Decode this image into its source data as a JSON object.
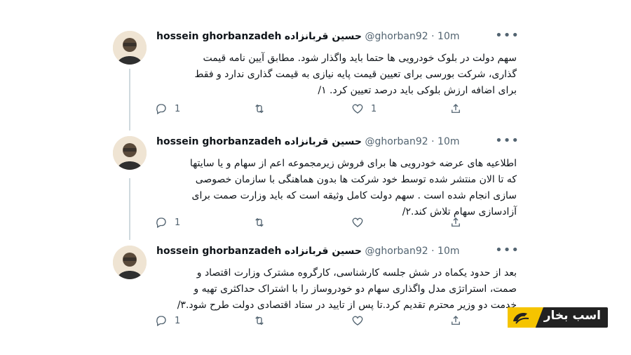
{
  "tweets": [
    {
      "name": "hossein ghorbanzadeh",
      "name_fa": "حسین قربانزاده",
      "handle": "@ghorban92",
      "time": "· 10m",
      "lines": [
        "سهم دولت در بلوک خودرویی ها حتما باید واگذار شود. مطابق آیین نامه قیمت",
        "گذاری، شرکت بورسی برای تعیین قیمت پایه نیازی به قیمت گذاری ندارد و فقط",
        "برای اضافه ارزش بلوکی باید درصد تعیین کرد. ۱/"
      ],
      "replies": "1",
      "retweets": "",
      "likes": "1"
    },
    {
      "name": "hossein ghorbanzadeh",
      "name_fa": "حسین قربانزاده",
      "handle": "@ghorban92",
      "time": "· 10m",
      "lines": [
        "اطلاعیه های عرضه خودرویی ها برای فروش زیرمجموعه اعم از سهام و یا سایتها",
        "که تا الان منتشر شده توسط خود شرکت ها بدون هماهنگی با سازمان خصوصی",
        "سازی انجام شده است . سهم دولت کامل وثیقه است که باید وزارت صمت برای",
        "آزادسازی سهام تلاش کند.۲/"
      ],
      "replies": "1",
      "retweets": "",
      "likes": ""
    },
    {
      "name": "hossein ghorbanzadeh",
      "name_fa": "حسین قربانزاده",
      "handle": "@ghorban92",
      "time": "· 10m",
      "lines": [
        "بعد از حدود یکماه در شش جلسه کارشناسی، کارگروه مشترک وزارت اقتصاد و",
        "صمت، استراتژی مدل واگذاری سهام دو خودروساز را با اشتراک حداکثری تهیه و",
        "خدمت دو وزیر محترم تقدیم کرد.تا پس از تایید در ستاد اقتصادی دولت طرح شود.۳/"
      ],
      "replies": "1",
      "retweets": "",
      "likes": ""
    }
  ],
  "logo": {
    "text": "اسب بخار"
  },
  "icons": [
    "more-icon",
    "reply-icon",
    "retweet-icon",
    "like-icon",
    "share-icon"
  ],
  "colors": {
    "text": "#0f1419",
    "muted": "#536471",
    "line": "#cfd9de",
    "logo_yellow": "#f5c400"
  }
}
